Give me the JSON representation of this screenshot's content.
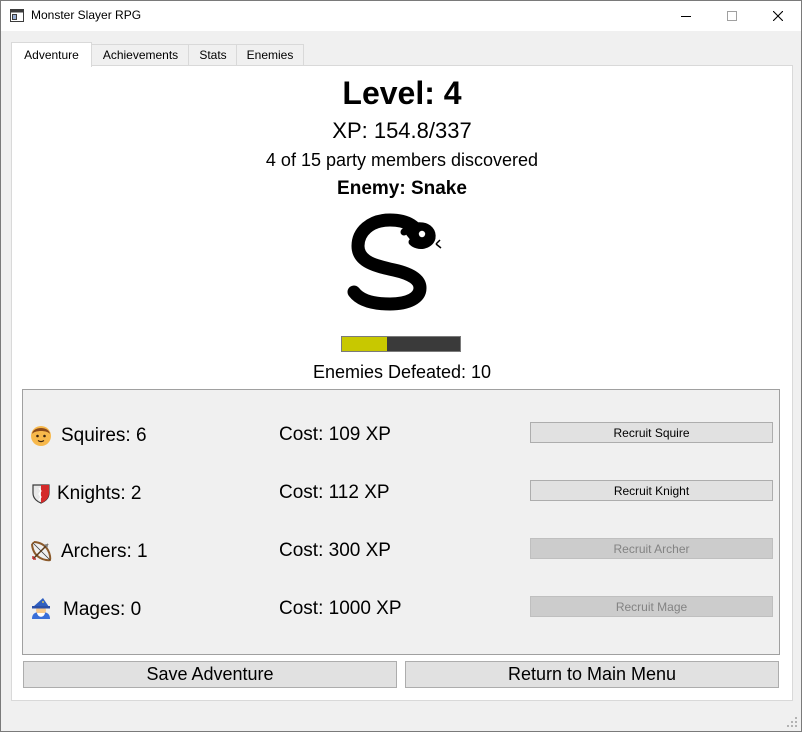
{
  "window": {
    "title": "Monster Slayer RPG",
    "controls": [
      "minimize",
      "maximize",
      "close"
    ]
  },
  "tabs": [
    {
      "label": "Adventure",
      "active": true
    },
    {
      "label": "Achievements",
      "active": false
    },
    {
      "label": "Stats",
      "active": false
    },
    {
      "label": "Enemies",
      "active": false
    }
  ],
  "adventure": {
    "level_text": "Level: 4",
    "xp_text": "XP: 154.8/337",
    "party_text": "4 of 15 party members discovered",
    "enemy_text": "Enemy: Snake",
    "enemy_icon": "snake-icon",
    "enemy_health_fraction": 0.38,
    "health_colors": {
      "fill": "#c8c800",
      "empty": "#3a3a3a"
    },
    "defeated_text": "Enemies Defeated: 10"
  },
  "units": [
    {
      "label": "Squires: 6",
      "cost": "Cost: 109 XP",
      "button": "Recruit Squire",
      "enabled": true,
      "icon": "squire-face-icon"
    },
    {
      "label": "Knights: 2",
      "cost": "Cost: 112 XP",
      "button": "Recruit Knight",
      "enabled": true,
      "icon": "shield-icon"
    },
    {
      "label": "Archers: 1",
      "cost": "Cost: 300 XP",
      "button": "Recruit Archer",
      "enabled": false,
      "icon": "bow-arrow-icon"
    },
    {
      "label": "Mages: 0",
      "cost": "Cost: 1000 XP",
      "button": "Recruit Mage",
      "enabled": false,
      "icon": "mage-icon"
    }
  ],
  "actions": {
    "save": "Save Adventure",
    "main_menu": "Return to Main Menu"
  }
}
